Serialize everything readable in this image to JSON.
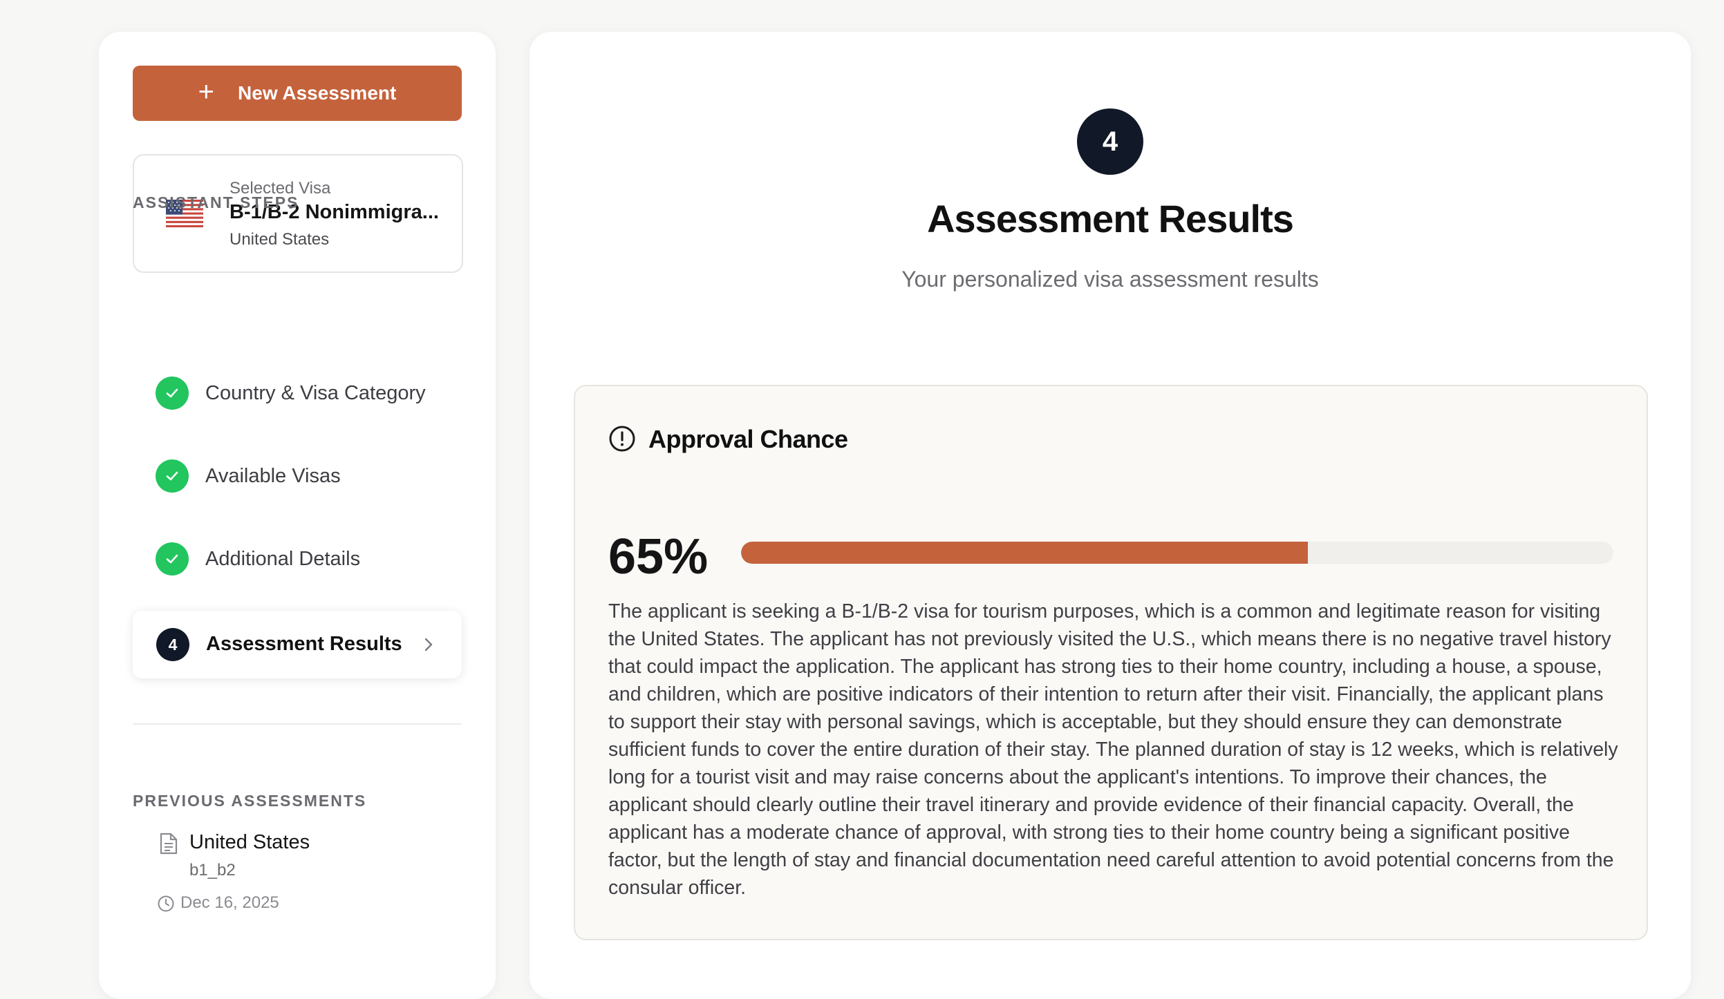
{
  "sidebar": {
    "new_button_label": "New Assessment",
    "selected_visa": {
      "caption": "Selected Visa",
      "name": "B-1/B-2 Nonimmigra...",
      "country": "United States"
    },
    "steps_heading": "ASSISTANT STEPS",
    "steps": [
      {
        "label": "Country & Visa Category",
        "status": "complete"
      },
      {
        "label": "Available Visas",
        "status": "complete"
      },
      {
        "label": "Additional Details",
        "status": "complete"
      },
      {
        "label": "Assessment Results",
        "status": "active",
        "number": "4"
      }
    ],
    "previous_heading": "PREVIOUS ASSESSMENTS",
    "previous": [
      {
        "country": "United States",
        "code": "b1_b2",
        "date": "Dec 16, 2025"
      }
    ]
  },
  "main": {
    "step_number": "4",
    "title": "Assessment Results",
    "subtitle": "Your personalized visa assessment results",
    "approval": {
      "heading": "Approval Chance",
      "percent_label": "65%",
      "percent_value": 65,
      "bar_color": "#c4623c",
      "description": "The applicant is seeking a B-1/B-2 visa for tourism purposes, which is a common and legitimate reason for visiting the United States. The applicant has not previously visited the U.S., which means there is no negative travel history that could impact the application. The applicant has strong ties to their home country, including a house, a spouse, and children, which are positive indicators of their intention to return after their visit. Financially, the applicant plans to support their stay with personal savings, which is acceptable, but they should ensure they can demonstrate sufficient funds to cover the entire duration of their stay. The planned duration of stay is 12 weeks, which is relatively long for a tourist visit and may raise concerns about the applicant's intentions. To improve their chances, the applicant should clearly outline their travel itinerary and provide evidence of their financial capacity. Overall, the applicant has a moderate chance of approval, with strong ties to their home country being a significant positive factor, but the length of stay and financial documentation need careful attention to avoid potential concerns from the consular officer."
    }
  },
  "colors": {
    "accent": "#c4623c",
    "success": "#22c55e",
    "dark": "#111827"
  }
}
